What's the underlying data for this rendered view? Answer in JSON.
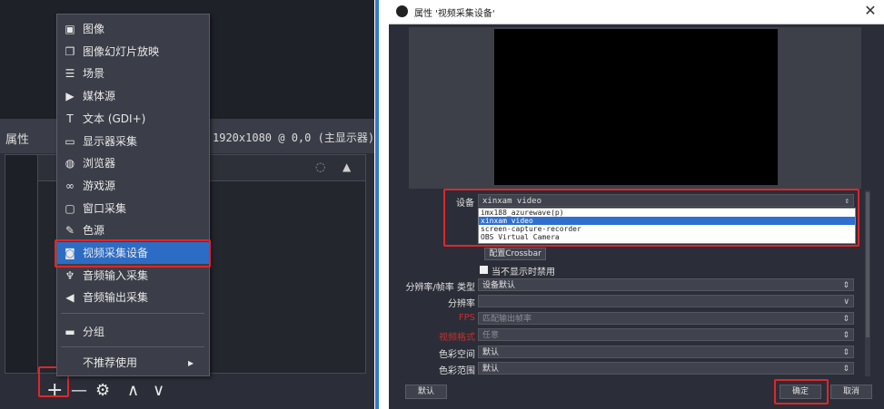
{
  "left": {
    "props_label": "属性",
    "resolution_text": "1920x1080 @ 0,0 (主显示器)",
    "menu": {
      "items": [
        {
          "icon": "image-icon",
          "glyph": "▣",
          "label": "图像"
        },
        {
          "icon": "slideshow-icon",
          "glyph": "❐",
          "label": "图像幻灯片放映"
        },
        {
          "icon": "scene-icon",
          "glyph": "☰",
          "label": "场景"
        },
        {
          "icon": "media-source-icon",
          "glyph": "▶",
          "label": "媒体源"
        },
        {
          "icon": "text-icon",
          "glyph": "T",
          "label": "文本 (GDI+)"
        },
        {
          "icon": "display-capture-icon",
          "glyph": "▭",
          "label": "显示器采集"
        },
        {
          "icon": "browser-icon",
          "glyph": "◍",
          "label": "浏览器"
        },
        {
          "icon": "game-capture-icon",
          "glyph": "∞",
          "label": "游戏源"
        },
        {
          "icon": "window-capture-icon",
          "glyph": "▢",
          "label": "窗口采集"
        },
        {
          "icon": "color-source-icon",
          "glyph": "✎",
          "label": "色源"
        },
        {
          "icon": "video-capture-icon",
          "glyph": "◙",
          "label": "视频采集设备"
        },
        {
          "icon": "audio-input-icon",
          "glyph": "♆",
          "label": "音频输入采集"
        },
        {
          "icon": "audio-output-icon",
          "glyph": "◀",
          "label": "音频输出采集"
        }
      ],
      "group_label": "分组",
      "group_glyph": "▬",
      "deprecated_label": "不推荐使用",
      "deprecated_arrow": "▸"
    },
    "toolbar": {
      "add": "+",
      "remove": "—",
      "settings": "⚙",
      "up": "∧",
      "down": "∨"
    },
    "source_eye": "◌",
    "source_lock": "▲"
  },
  "dialog": {
    "title": "属性 '视频采集设备'",
    "close": "✕",
    "device_label": "设备",
    "device_value": "xinxam video",
    "device_options": [
      "imx188_azurewave(p)",
      "xinxam video",
      "screen-capture-recorder",
      "OBS Virtual Camera"
    ],
    "selected_option_index": 1,
    "crossbar_button": "配置Crossbar",
    "deactivate_checkbox": "当不显示时禁用",
    "rows": [
      {
        "label": "分辨率/帧率 类型",
        "value": "设备默认",
        "red": false,
        "dim": false
      },
      {
        "label": "分辨率",
        "value": "",
        "red": false,
        "dim": false
      },
      {
        "label": "FPS",
        "value": "匹配输出帧率",
        "red": true,
        "dim": true
      },
      {
        "label": "视频格式",
        "value": "任意",
        "red": true,
        "dim": true
      },
      {
        "label": "色彩空间",
        "value": "默认",
        "red": false,
        "dim": false
      },
      {
        "label": "色彩范围",
        "value": "默认",
        "red": false,
        "dim": false
      }
    ],
    "defaults_button": "默认",
    "ok_button": "确定",
    "cancel_button": "取消"
  },
  "colors": {
    "accent_red": "#e0262a",
    "selection_blue": "#2c6cc4",
    "divider_blue": "#2f7bd2"
  }
}
